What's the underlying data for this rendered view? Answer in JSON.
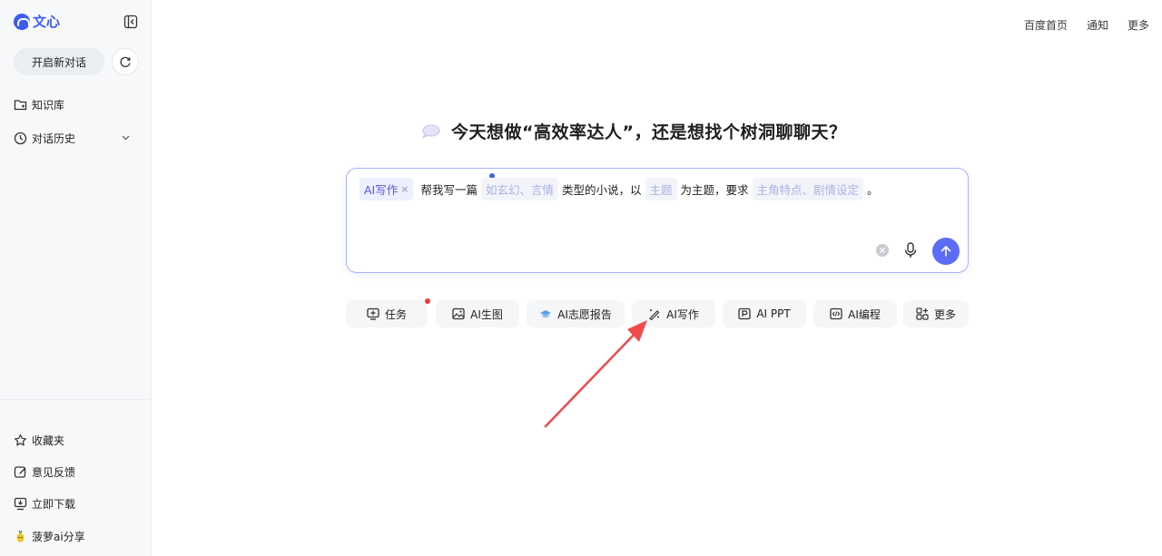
{
  "sidebar": {
    "logo_text": "文心",
    "new_chat_label": "开启新对话",
    "items": [
      {
        "label": "知识库",
        "icon": "folder-icon"
      },
      {
        "label": "对话历史",
        "icon": "clock-icon"
      }
    ],
    "bottom_items": [
      {
        "label": "收藏夹",
        "icon": "star-icon"
      },
      {
        "label": "意见反馈",
        "icon": "feedback-icon"
      },
      {
        "label": "立即下载",
        "icon": "download-icon"
      },
      {
        "label": "菠萝ai分享",
        "icon": "pineapple-icon"
      }
    ]
  },
  "header": {
    "links": [
      "百度首页",
      "通知",
      "更多"
    ]
  },
  "main": {
    "headline": "今天想做“高效率达人”，还是想找个树洞聊聊天？",
    "prompt": {
      "tag": "AI写作",
      "tag_close": "×",
      "segments": [
        {
          "type": "text",
          "value": "帮我写一篇"
        },
        {
          "type": "slot",
          "value": "如玄幻、言情"
        },
        {
          "type": "text",
          "value": "类型的小说，以"
        },
        {
          "type": "slot",
          "value": "主题"
        },
        {
          "type": "text",
          "value": "为主题，要求"
        },
        {
          "type": "slot",
          "value": "主角特点、剧情设定"
        },
        {
          "type": "text",
          "value": "。"
        }
      ]
    },
    "tools": [
      {
        "label": "任务",
        "icon": "task-icon",
        "badge": true
      },
      {
        "label": "AI生图",
        "icon": "image-icon"
      },
      {
        "label": "AI志愿报告",
        "icon": "graduation-cap-icon"
      },
      {
        "label": "AI写作",
        "icon": "magic-pen-icon"
      },
      {
        "label": "AI PPT",
        "icon": "ppt-icon"
      },
      {
        "label": "AI编程",
        "icon": "code-icon"
      },
      {
        "label": "更多",
        "icon": "apps-icon"
      }
    ]
  },
  "colors": {
    "accent": "#5b6cf6",
    "annotation_arrow": "#ef4b4b",
    "badge": "#f23a3a"
  }
}
